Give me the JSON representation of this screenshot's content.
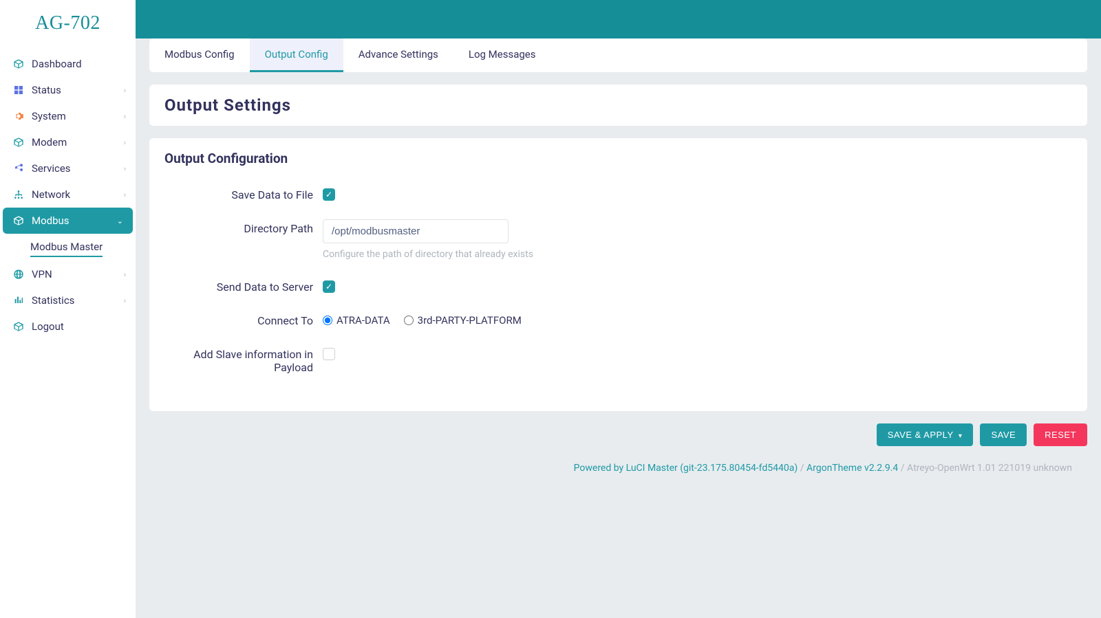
{
  "brand": "AG-702",
  "sidebar": {
    "items": [
      {
        "label": "Dashboard",
        "icon": "cube",
        "color": "teal",
        "expandable": false
      },
      {
        "label": "Status",
        "icon": "grid",
        "color": "blue",
        "expandable": true
      },
      {
        "label": "System",
        "icon": "gear",
        "color": "orange",
        "expandable": true
      },
      {
        "label": "Modem",
        "icon": "cube",
        "color": "teal",
        "expandable": true
      },
      {
        "label": "Services",
        "icon": "share",
        "color": "blue",
        "expandable": true
      },
      {
        "label": "Network",
        "icon": "tree",
        "color": "teal",
        "expandable": true
      },
      {
        "label": "Modbus",
        "icon": "cube",
        "color": "white",
        "expandable": true,
        "active": true,
        "children": [
          {
            "label": "Modbus Master",
            "active": true
          }
        ]
      },
      {
        "label": "VPN",
        "icon": "globe",
        "color": "teal",
        "expandable": true
      },
      {
        "label": "Statistics",
        "icon": "bars",
        "color": "teal",
        "expandable": true
      },
      {
        "label": "Logout",
        "icon": "cube",
        "color": "teal",
        "expandable": false
      }
    ]
  },
  "tabs": [
    {
      "label": "Modbus Config"
    },
    {
      "label": "Output Config",
      "active": true
    },
    {
      "label": "Advance Settings"
    },
    {
      "label": "Log Messages"
    }
  ],
  "page": {
    "title": "Output Settings",
    "section_title": "Output Configuration"
  },
  "form": {
    "save_to_file": {
      "label": "Save Data to File",
      "checked": true
    },
    "directory_path": {
      "label": "Directory Path",
      "value": "/opt/modbusmaster",
      "help": "Configure the path of directory that already exists"
    },
    "send_to_server": {
      "label": "Send Data to Server",
      "checked": true
    },
    "connect_to": {
      "label": "Connect To",
      "options": [
        "ATRA-DATA",
        "3rd-PARTY-PLATFORM"
      ],
      "selected": "ATRA-DATA"
    },
    "add_slave_info": {
      "label": "Add Slave information in Payload",
      "checked": false
    }
  },
  "buttons": {
    "save_apply": "SAVE & APPLY",
    "save": "SAVE",
    "reset": "RESET"
  },
  "footer": {
    "luci": "Powered by LuCI Master (git-23.175.80454-fd5440a)",
    "theme": "ArgonTheme v2.2.9.4",
    "version": "Atreyo-OpenWrt 1.01 221019 unknown"
  }
}
